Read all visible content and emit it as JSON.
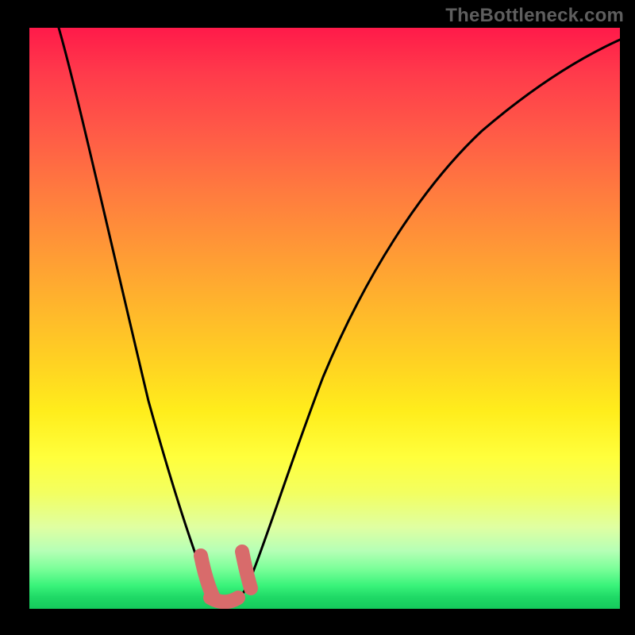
{
  "watermark": "TheBottleneck.com",
  "chart_data": {
    "type": "line",
    "title": "",
    "xlabel": "",
    "ylabel": "",
    "xlim": [
      0,
      100
    ],
    "ylim": [
      0,
      100
    ],
    "grid": false,
    "legend": false,
    "series": [
      {
        "name": "curve",
        "x": [
          5,
          8,
          12,
          16,
          20,
          23,
          25,
          27,
          29,
          30,
          31,
          32,
          33,
          35,
          37,
          39,
          42,
          46,
          50,
          55,
          60,
          66,
          73,
          80,
          88,
          95,
          100
        ],
        "y": [
          100,
          85,
          68,
          52,
          37,
          25,
          17,
          10,
          5,
          3,
          2,
          2,
          3,
          6,
          12,
          20,
          30,
          42,
          52,
          61,
          69,
          75,
          81,
          86,
          90,
          93,
          95
        ]
      }
    ],
    "markers": [
      {
        "name": "marker-left",
        "x_range": [
          28.5,
          30.5
        ],
        "y_range": [
          2,
          9
        ]
      },
      {
        "name": "marker-right",
        "x_range": [
          34.5,
          36.0
        ],
        "y_range": [
          4,
          10
        ]
      },
      {
        "name": "marker-bottom",
        "x_range": [
          29.5,
          34.5
        ],
        "y_range": [
          1,
          4
        ]
      }
    ],
    "marker_color": "#d86b6b"
  }
}
